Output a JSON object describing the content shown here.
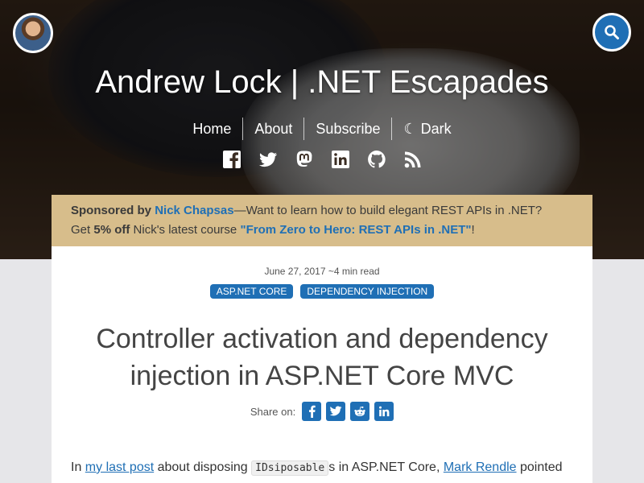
{
  "header": {
    "site_title": "Andrew Lock | .NET Escapades",
    "avatar_alt": "Andrew Lock avatar"
  },
  "nav": {
    "items": [
      "Home",
      "About",
      "Subscribe",
      "☾ Dark"
    ]
  },
  "social_icons": [
    "facebook-icon",
    "twitter-icon",
    "mastodon-icon",
    "linkedin-icon",
    "github-icon",
    "rss-icon"
  ],
  "sponsor": {
    "prefix": "Sponsored by",
    "sponsor_name": "Nick Chapsas",
    "line1_rest": "—Want to learn how to build elegant REST APIs in .NET?",
    "line2_start": "Get",
    "discount": "5% off",
    "line2_mid": "Nick's latest course",
    "course": "\"From Zero to Hero: REST APIs in .NET\"",
    "line2_end": "!"
  },
  "post": {
    "meta": "June 27, 2017 ~4 min read",
    "tags": [
      "ASP.NET CORE",
      "DEPENDENCY INJECTION"
    ],
    "title": "Controller activation and dependency injection in ASP.NET Core MVC",
    "share_label": "Share on:",
    "intro": {
      "t1": "In",
      "link1": "my last post",
      "t2": "about disposing",
      "code": "IDsiposable",
      "t3": "s in ASP.NET Core,",
      "link2": "Mark Rendle",
      "t4": "pointed"
    }
  },
  "colors": {
    "accent": "#1f6fb5",
    "sponsor_bg": "#d7bd8b",
    "page_bg": "#e6e6e9"
  }
}
